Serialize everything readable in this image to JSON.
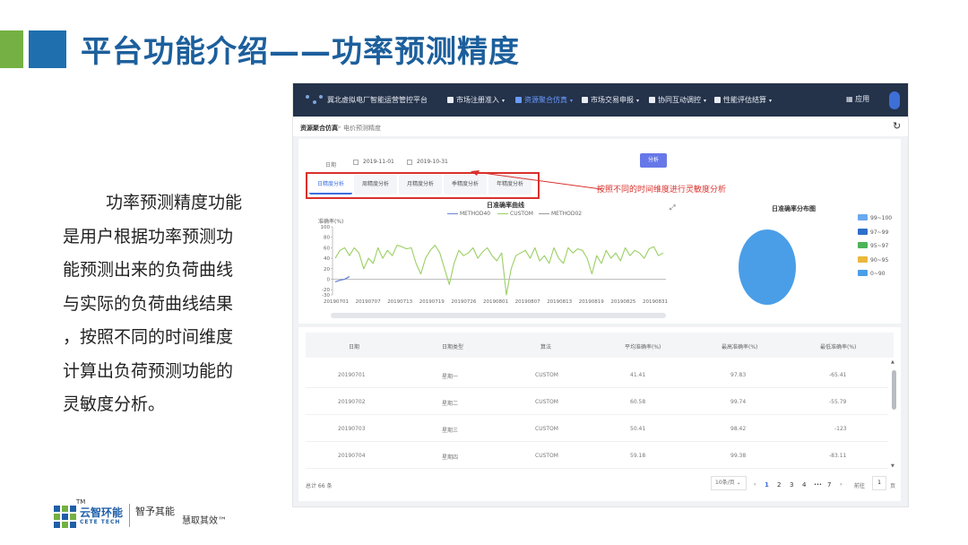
{
  "slide": {
    "title": "平台功能介绍——功率预测精度",
    "description_lines": [
      "功率预测精度功能",
      "是用户根据功率预测功",
      "能预测出来的负荷曲线",
      "与实际的负荷曲线结果",
      "，按照不同的时间维度",
      "计算出负荷预测功能的",
      "灵敏度分析。"
    ],
    "footer": {
      "logo_cn": "云智环能",
      "logo_en": "CETE TECH",
      "logo_tm": "TM",
      "slogan_1": "智予其能",
      "slogan_2": "慧取其效™"
    },
    "colors": {
      "title": "#1c5f9c",
      "accent_blue": "#1f6fae",
      "accent_green": "#74b043",
      "annotation_red": "#d9312d"
    }
  },
  "app": {
    "brand": "冀北虚拟电厂智能运营管控平台",
    "nav": [
      {
        "label": "市场注册准入",
        "icon": "user-icon",
        "active": false
      },
      {
        "label": "资源聚合仿真",
        "icon": "cluster-icon",
        "active": true
      },
      {
        "label": "市场交易申报",
        "icon": "trade-icon",
        "active": false
      },
      {
        "label": "协同互动调控",
        "icon": "control-icon",
        "active": false
      },
      {
        "label": "性能评估结算",
        "icon": "gear-icon",
        "active": false
      }
    ],
    "apps_label": "应用",
    "breadcrumb": {
      "root": "资源聚合仿真",
      "separator": ">",
      "current": "电价预测精度"
    },
    "filter": {
      "date_label": "日期",
      "start_date": "2019-11-01",
      "end_date": "2019-10-31",
      "analyze_label": "分析"
    },
    "tabs": [
      "日精度分析",
      "周精度分析",
      "月精度分析",
      "季精度分析",
      "年精度分析"
    ],
    "annotation": "按照不同的时间维度进行灵敏度分析",
    "line_chart": {
      "title": "日准确率曲线",
      "legend": [
        "METHOD40",
        "CUSTOM",
        "METHOD02"
      ],
      "y_title": "准确率(%)"
    },
    "pie_chart": {
      "title": "日准确率分布图",
      "legend": [
        {
          "label": "99~100",
          "color": "#6aa9ef"
        },
        {
          "label": "97~99",
          "color": "#2f6fc9"
        },
        {
          "label": "95~97",
          "color": "#4cb35a"
        },
        {
          "label": "90~95",
          "color": "#e9b83d"
        },
        {
          "label": "0~90",
          "color": "#4a9ee8"
        }
      ]
    },
    "table": {
      "headers": [
        "日期",
        "日期类型",
        "算法",
        "平均准确率(%)",
        "最高准确率(%)",
        "最低准确率(%)"
      ],
      "rows": [
        [
          "20190701",
          "星期一",
          "CUSTOM",
          "41.41",
          "97.83",
          "-65.41"
        ],
        [
          "20190702",
          "星期二",
          "CUSTOM",
          "60.58",
          "99.74",
          "-55.79"
        ],
        [
          "20190703",
          "星期三",
          "CUSTOM",
          "50.41",
          "98.42",
          "-123"
        ],
        [
          "20190704",
          "星期四",
          "CUSTOM",
          "59.18",
          "99.38",
          "-83.11"
        ]
      ]
    },
    "pager": {
      "total": "总计 66 条",
      "page_size": "10条/页",
      "pages": [
        "1",
        "2",
        "3",
        "4",
        "•••",
        "7"
      ],
      "current_page": "1",
      "goto_label": "前往",
      "goto_value": "1",
      "page_unit": "页"
    }
  },
  "chart_data": {
    "type": "line",
    "title": "日准确率曲线",
    "ylabel": "准确率(%)",
    "ylim": [
      -30,
      100
    ],
    "yticks": [
      100,
      80,
      60,
      40,
      20,
      0,
      -20,
      -30
    ],
    "xticks": [
      "20190701",
      "20190707",
      "20190713",
      "20190719",
      "20190726",
      "20190801",
      "20190807",
      "20190813",
      "20190819",
      "20190825",
      "20190831"
    ],
    "series": [
      {
        "name": "CUSTOM",
        "color": "#9bcf63",
        "values": [
          40,
          55,
          60,
          45,
          60,
          50,
          20,
          40,
          30,
          60,
          40,
          55,
          45,
          65,
          62,
          58,
          60,
          30,
          10,
          40,
          55,
          65,
          50,
          20,
          -10,
          30,
          55,
          45,
          50,
          60,
          40,
          52,
          60,
          45,
          35,
          50,
          -30,
          20,
          45,
          50,
          55,
          40,
          60,
          35,
          45,
          30,
          60,
          40,
          30,
          60,
          50,
          58,
          55,
          40,
          10,
          45,
          30,
          55,
          40,
          50,
          35,
          60,
          45,
          55,
          50,
          40,
          58,
          62,
          45,
          50
        ]
      },
      {
        "name": "METHOD40",
        "color": "#6d84d6",
        "values": [
          -5,
          -2,
          0,
          5
        ]
      }
    ]
  }
}
